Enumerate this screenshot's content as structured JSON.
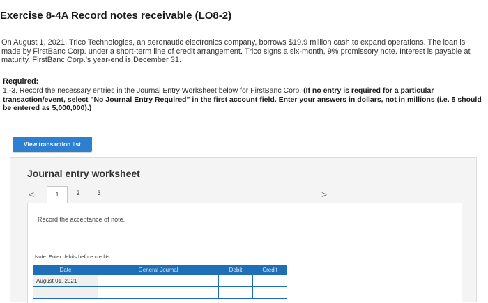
{
  "header": {
    "title": "Exercise 8-4A Record notes receivable (LO8-2)"
  },
  "problem": {
    "text": "On August 1, 2021, Trico Technologies, an aeronautic electronics company, borrows $19.9 million cash to expand operations. The loan is made by FirstBanc Corp. under a short-term line of credit arrangement. Trico signs a six-month, 9% promissory note. Interest is payable at maturity. FirstBanc Corp.'s year-end is December 31."
  },
  "required": {
    "heading": "Required:",
    "text": "1.-3. Record the necessary entries in the Journal Entry Worksheet below for FirstBanc Corp.",
    "emphasis": "(If no entry is required for a particular transaction/event, select \"No Journal Entry Required\" in the first account field. Enter your answers in dollars, not in millions (i.e. 5 should be entered as 5,000,000).)"
  },
  "buttons": {
    "view_transactions": "View transaction list"
  },
  "worksheet": {
    "title": "Journal entry worksheet",
    "prev_arrow": "<",
    "next_arrow": ">",
    "tabs": [
      "1",
      "2",
      "3"
    ],
    "active_tab": "1",
    "instruction": "Record the acceptance of note.",
    "note": "Note: Enter debits before credits.",
    "table": {
      "headers": [
        "Date",
        "General Journal",
        "Debit",
        "Credit"
      ],
      "rows": [
        {
          "date": "August 01, 2021",
          "account": "",
          "debit": "",
          "credit": ""
        },
        {
          "date": "",
          "account": "",
          "debit": "",
          "credit": ""
        }
      ]
    }
  },
  "colors": {
    "button_bg": "#2f7fd0",
    "table_header": "#1e6fb8",
    "panel_bg": "#f4f4f4"
  }
}
